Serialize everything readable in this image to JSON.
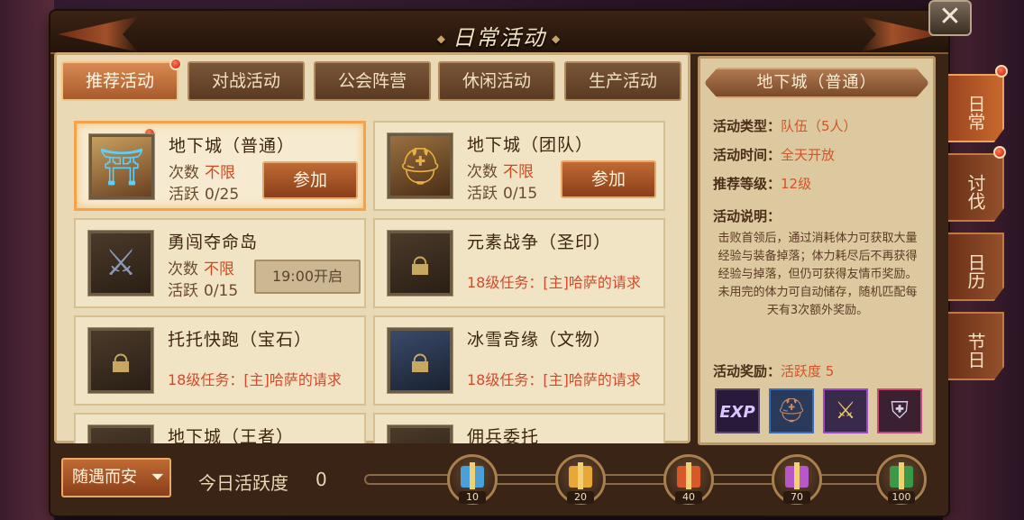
{
  "window": {
    "title": "日常活动"
  },
  "tabs": [
    {
      "label": "推荐活动",
      "active": true,
      "has_dot": true
    },
    {
      "label": "对战活动",
      "active": false
    },
    {
      "label": "公会阵营",
      "active": false
    },
    {
      "label": "休闲活动",
      "active": false
    },
    {
      "label": "生产活动",
      "active": false
    }
  ],
  "cards": [
    {
      "name": "地下城（普通）",
      "count_label": "次数",
      "count_value": "不限",
      "activity_label": "活跃",
      "activity_value": "0/25",
      "button": "参加",
      "selected": true,
      "has_dot": true,
      "icon": "portal-icon"
    },
    {
      "name": "地下城（团队）",
      "count_label": "次数",
      "count_value": "不限",
      "activity_label": "活跃",
      "activity_value": "0/15",
      "button": "参加",
      "icon": "helmet-icon"
    },
    {
      "name": "勇闯夺命岛",
      "count_label": "次数",
      "count_value": "不限",
      "activity_label": "活跃",
      "activity_value": "0/15",
      "time_button": "19:00开启",
      "icon": "warrior-icon"
    },
    {
      "name": "元素战争（圣印）",
      "quest": "18级任务：[主]哈萨的请求",
      "icon": "lock-icon"
    },
    {
      "name": "托托快跑（宝石）",
      "quest": "18级任务：[主]哈萨的请求",
      "icon": "lock-icon"
    },
    {
      "name": "冰雪奇缘（文物）",
      "quest": "18级任务：[主]哈萨的请求",
      "icon": "lock-icon"
    },
    {
      "name": "地下城（王者）",
      "icon": "lock-icon"
    },
    {
      "name": "佣兵委托",
      "icon": "lock-icon"
    }
  ],
  "info": {
    "title": "地下城（普通）",
    "type_label": "活动类型：",
    "type_value": "队伍（5人）",
    "time_label": "活动时间：",
    "time_value": "全天开放",
    "level_label": "推荐等级：",
    "level_value": "12级",
    "desc_label": "活动说明：",
    "desc_1": "击败首领后，通过消耗体力可获取大量经验与装备掉落；体力耗尽后不再获得经验与掉落，但仍可获得友情币奖励。",
    "desc_2": "未用完的体力可自动储存，随机匹配每天有3次额外奖励。",
    "reward_label": "活动奖励：",
    "reward_value": "活跃度 5",
    "rewards": [
      {
        "icon": "exp-icon",
        "text": "EXP"
      },
      {
        "icon": "helmet-reward-icon"
      },
      {
        "icon": "weapon-reward-icon"
      },
      {
        "icon": "armor-reward-icon"
      }
    ]
  },
  "side_tabs": [
    {
      "label": "日常",
      "active": true,
      "has_dot": true
    },
    {
      "label": "讨伐",
      "active": false,
      "has_dot": true
    },
    {
      "label": "日历",
      "active": false
    },
    {
      "label": "节日",
      "active": false
    }
  ],
  "bottom": {
    "safe_button": "随遇而安",
    "today_label": "今日活跃度",
    "today_value": "0",
    "progress": 0,
    "gifts": [
      {
        "value": "10",
        "color": "#4aa0d8"
      },
      {
        "value": "20",
        "color": "#e8a838"
      },
      {
        "value": "40",
        "color": "#d8582a"
      },
      {
        "value": "70",
        "color": "#b858c8"
      },
      {
        "value": "100",
        "color": "#3a9a48"
      }
    ]
  }
}
